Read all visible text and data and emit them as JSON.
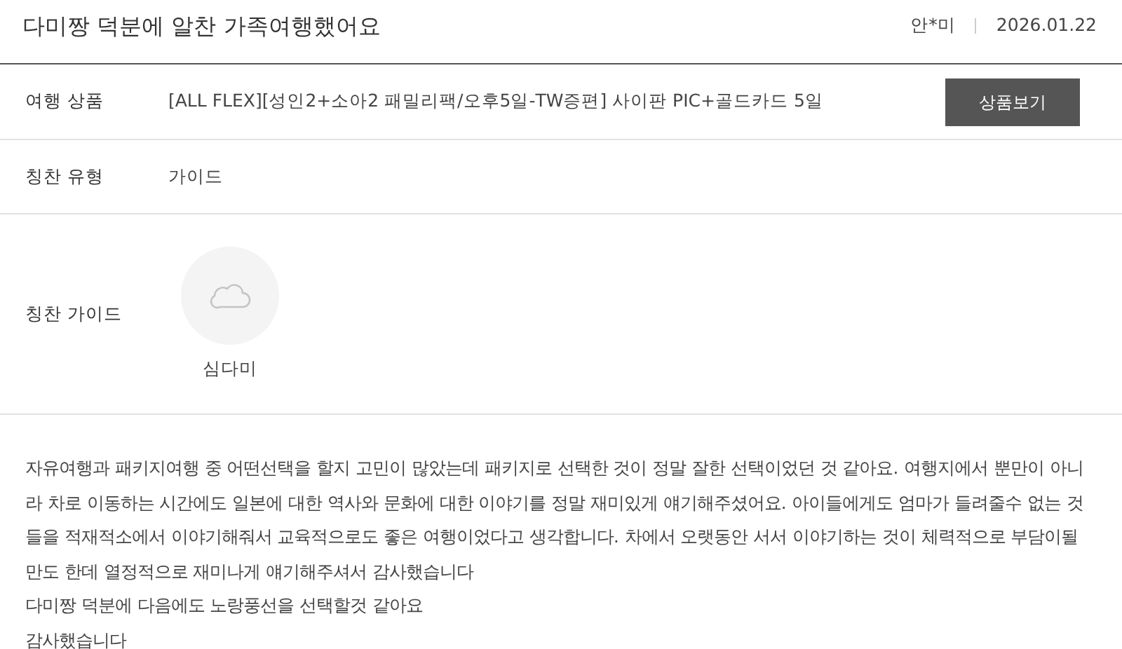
{
  "review": {
    "title": "다미짱 덕분에 알찬 가족여행했어요",
    "author": "안*미",
    "date": "2026.01.22"
  },
  "fields": [
    {
      "kind": "product",
      "label": "여행 상품",
      "value": "[ALL FLEX][성인2+소아2 패밀리팩/오후5일-TW증편] 사이판 PIC+골드카드 5일",
      "button": "상품보기"
    },
    {
      "kind": "text",
      "label": "칭찬 유형",
      "value": "가이드"
    },
    {
      "kind": "guide",
      "label": "칭찬 가이드",
      "value": "심다미"
    }
  ],
  "body": [
    "자유여행과 패키지여행 중 어떤선택을 할지 고민이 많았는데 패키지로 선택한 것이 정말 잘한 선택이었던 것 같아요. 여행지에서 뿐만이 아니라 차로 이동하는 시간에도 일본에 대한 역사와 문화에 대한 이야기를 정말 재미있게 얘기해주셨어요. 아이들에게도 엄마가 들려줄수 없는 것들을 적재적소에서 이야기해줘서 교육적으로도 좋은 여행이었다고 생각합니다. 차에서 오랫동안 서서 이야기하는 것이 체력적으로 부담이될 만도 한데 열정적으로 재미나게 얘기해주셔서 감사했습니다",
    "다미짱 덕분에 다음에도 노랑풍선을 선택할것 같아요",
    "감사했습니다"
  ]
}
